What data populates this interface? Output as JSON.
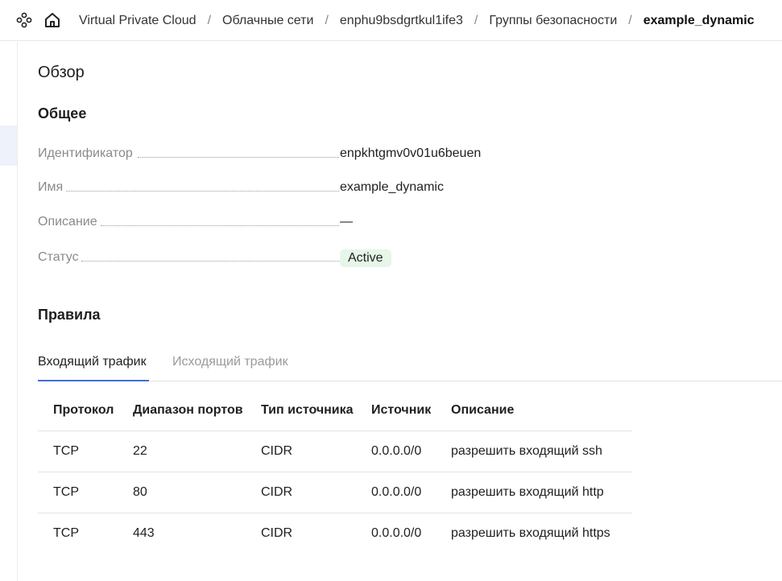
{
  "header": {
    "services_icon": "services-grid-icon",
    "home_icon": "home-icon",
    "breadcrumbs": [
      "Virtual Private Cloud",
      "Облачные сети",
      "enphu9bsdgrtkul1ife3",
      "Группы безопасности",
      "example_dynamic"
    ],
    "separator": "/"
  },
  "overview": {
    "title": "Обзор"
  },
  "general": {
    "title": "Общее",
    "props": [
      {
        "key": "Идентификатор",
        "value": "enpkhtgmv0v01u6beuen"
      },
      {
        "key": "Имя",
        "value": "example_dynamic"
      },
      {
        "key": "Описание",
        "value": "—"
      },
      {
        "key": "Статус",
        "value": "Active"
      }
    ],
    "status_color": "#2e9e3c"
  },
  "rules": {
    "title": "Правила",
    "tabs": [
      "Входящий трафик",
      "Исходящий трафик"
    ],
    "active_tab": "Входящий трафик",
    "columns": [
      "Протокол",
      "Диапазон портов",
      "Тип источника",
      "Источник",
      "Описание"
    ],
    "rows": [
      [
        "TCP",
        "22",
        "CIDR",
        "0.0.0.0/0",
        "разрешить входящий ssh"
      ],
      [
        "TCP",
        "80",
        "CIDR",
        "0.0.0.0/0",
        "разрешить входящий http"
      ],
      [
        "TCP",
        "443",
        "CIDR",
        "0.0.0.0/0",
        "разрешить входящий https"
      ]
    ]
  },
  "colors": {
    "accent": "#3f6fd8",
    "badge_bg": "#e6f6e8"
  }
}
